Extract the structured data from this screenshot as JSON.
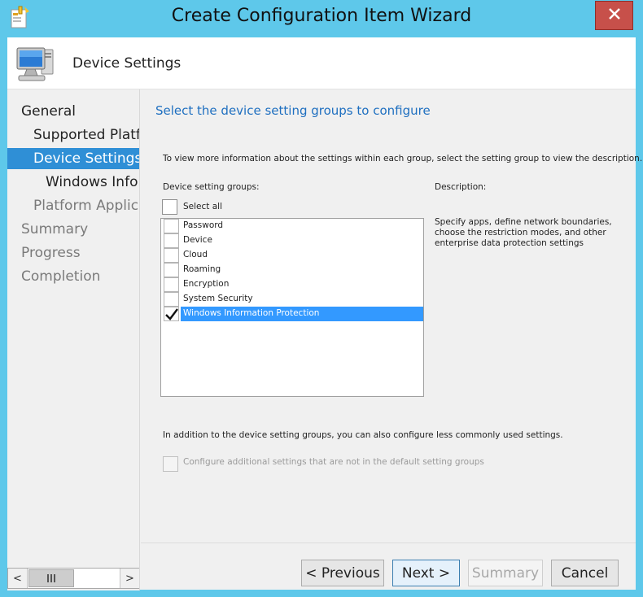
{
  "window": {
    "title": "Create Configuration Item Wizard",
    "close_glyph": "✕"
  },
  "header": {
    "title": "Device Settings"
  },
  "nav": {
    "items": [
      {
        "label": "General",
        "state": "normal"
      },
      {
        "label": "Supported Platforms",
        "state": "normal"
      },
      {
        "label": "Device Settings",
        "state": "selected"
      },
      {
        "label": "Windows Information Protection",
        "state": "normal"
      },
      {
        "label": "Platform Applicability",
        "state": "dim"
      },
      {
        "label": "Summary",
        "state": "dim"
      },
      {
        "label": "Progress",
        "state": "dim"
      },
      {
        "label": "Completion",
        "state": "dim"
      }
    ],
    "scroll_left": "<",
    "scroll_right": ">",
    "scroll_thumb_glyph": "|||"
  },
  "main": {
    "title": "Select the device setting groups to configure",
    "intro": "To view more information about the settings within each group, select the setting group to view the description.",
    "groups_label": "Device setting groups:",
    "select_all_label": "Select all",
    "select_all_checked": false,
    "groups": [
      {
        "label": "Password",
        "checked": false
      },
      {
        "label": "Device",
        "checked": false
      },
      {
        "label": "Cloud",
        "checked": false
      },
      {
        "label": "Roaming",
        "checked": false
      },
      {
        "label": "Encryption",
        "checked": false
      },
      {
        "label": "System Security",
        "checked": false
      },
      {
        "label": "Windows Information Protection",
        "checked": true
      }
    ],
    "description_label": "Description:",
    "description_text": "Specify apps, define network boundaries, choose the restriction modes, and other enterprise data protection settings",
    "additional_text": "In addition to the device setting groups, you can also configure less commonly used settings.",
    "additional_checkbox_label": "Configure additional settings that are not in the default setting groups"
  },
  "buttons": {
    "previous": "< Previous",
    "next": "Next >",
    "summary": "Summary",
    "cancel": "Cancel"
  },
  "colors": {
    "accent": "#2f8fd6",
    "list_selection": "#3399ff",
    "title_blue": "#1e6fc0",
    "close_red": "#c7504a",
    "frame": "#5ec8ea"
  }
}
